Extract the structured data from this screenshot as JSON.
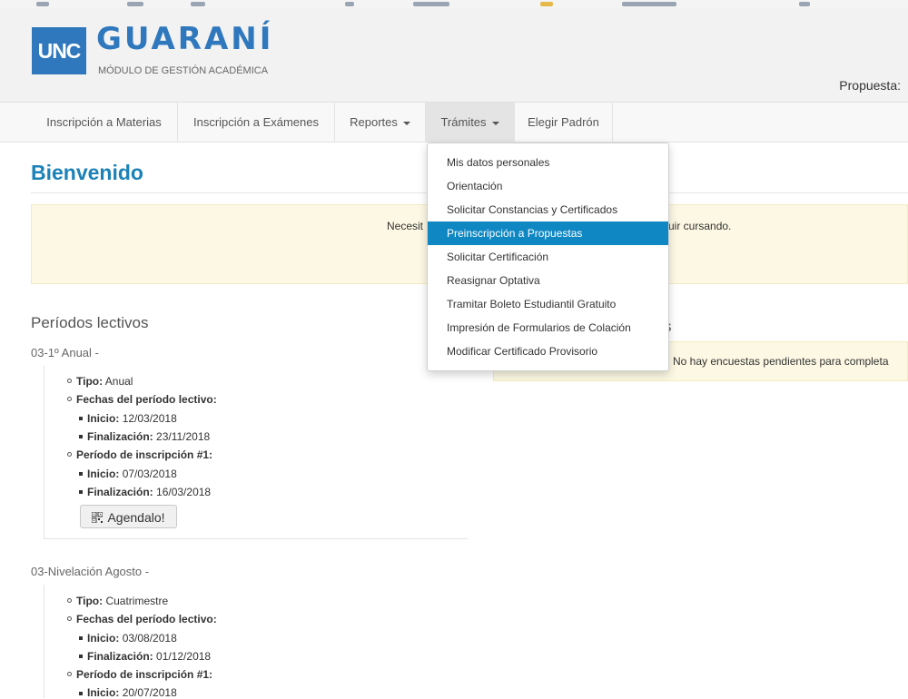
{
  "header": {
    "logo_badge": "UNC",
    "logo_title": "GUARANÍ",
    "logo_subtitle": "MÓDULO DE GESTIÓN ACADÉMICA",
    "propuesta_label": "Propuesta:"
  },
  "nav": {
    "items": [
      {
        "label": "Inscripción a Materias"
      },
      {
        "label": "Inscripción a Exámenes"
      },
      {
        "label": "Reportes"
      },
      {
        "label": "Trámites"
      },
      {
        "label": "Elegir Padrón"
      }
    ]
  },
  "main": {
    "title": "Bienvenido",
    "alert_left": "Necesit",
    "alert_right": "uir cursando.",
    "periodos_title": "Períodos lectivos",
    "encuestas_mark": "s",
    "encuestas_text": "No hay encuestas pendientes para completa"
  },
  "periodos": [
    {
      "title": "03-1º Anual -",
      "tipo_label": "Tipo:",
      "tipo_value": "Anual",
      "fechas_label": "Fechas del período lectivo:",
      "inicio_label": "Inicio:",
      "inicio_value": "12/03/2018",
      "fin_label": "Finalización:",
      "fin_value": "23/11/2018",
      "insc_label": "Período de inscripción #1:",
      "insc_inicio_label": "Inicio:",
      "insc_inicio_value": "07/03/2018",
      "insc_fin_label": "Finalización:",
      "insc_fin_value": "16/03/2018",
      "button": "Agendalo!"
    },
    {
      "title": "03-Nivelación Agosto -",
      "tipo_label": "Tipo:",
      "tipo_value": "Cuatrimestre",
      "fechas_label": "Fechas del período lectivo:",
      "inicio_label": "Inicio:",
      "inicio_value": "03/08/2018",
      "fin_label": "Finalización:",
      "fin_value": "01/12/2018",
      "insc_label": "Período de inscripción #1:",
      "insc_inicio_label": "Inicio:",
      "insc_inicio_value": "20/07/2018"
    }
  ],
  "dropdown": {
    "items": [
      {
        "label": "Mis datos personales"
      },
      {
        "label": "Orientación"
      },
      {
        "label": "Solicitar Constancias y Certificados"
      },
      {
        "label": "Preinscripción a Propuestas"
      },
      {
        "label": "Solicitar Certificación"
      },
      {
        "label": "Reasignar Optativa"
      },
      {
        "label": "Tramitar Boleto Estudiantil Gratuito"
      },
      {
        "label": "Impresión de Formularios de Colación"
      },
      {
        "label": "Modificar Certificado Provisorio"
      }
    ]
  },
  "colors": {
    "brand": "#2f78bd",
    "title": "#1b82b8",
    "highlight": "#0e87c3",
    "alert_bg": "#fcf8e3"
  }
}
